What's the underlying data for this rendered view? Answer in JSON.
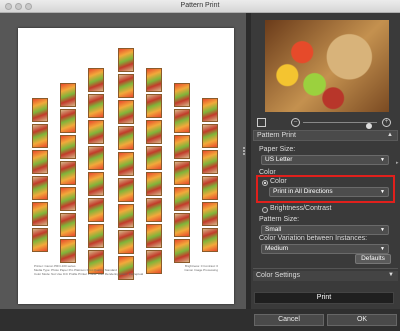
{
  "window": {
    "title": "Pattern Print"
  },
  "sheet": {
    "footer_left": "Printer: Canon PRO-100 series\nMedia Type: Photo Paper Pro Platinum   Print Quality: Standard\nColor Mode: Not Use ICC Profile   Printer Profile: Auto   Rendering Intent: Perceptual",
    "footer_right": "Brightness: 0  Contrast: 0\nCanon Image Processing"
  },
  "panel": {
    "title": "Pattern Print",
    "paper_size_label": "Paper Size:",
    "paper_size_value": "US Letter",
    "color_section_label": "Color",
    "color_radio_label": "Color",
    "color_select_value": "Print in All Directions",
    "brightness_label": "Brightness/Contrast",
    "pattern_size_label": "Pattern Size:",
    "pattern_size_value": "Small",
    "variation_label": "Color Variation between Instances:",
    "variation_value": "Medium",
    "defaults_label": "Defaults",
    "color_settings_label": "Color Settings"
  },
  "buttons": {
    "print": "Print",
    "cancel": "Cancel",
    "ok": "OK"
  },
  "icons": [
    "view-mode-icon",
    "zoom-out-icon",
    "zoom-in-icon",
    "disclosure-triangle-icon",
    "dropdown-arrow-icon"
  ]
}
